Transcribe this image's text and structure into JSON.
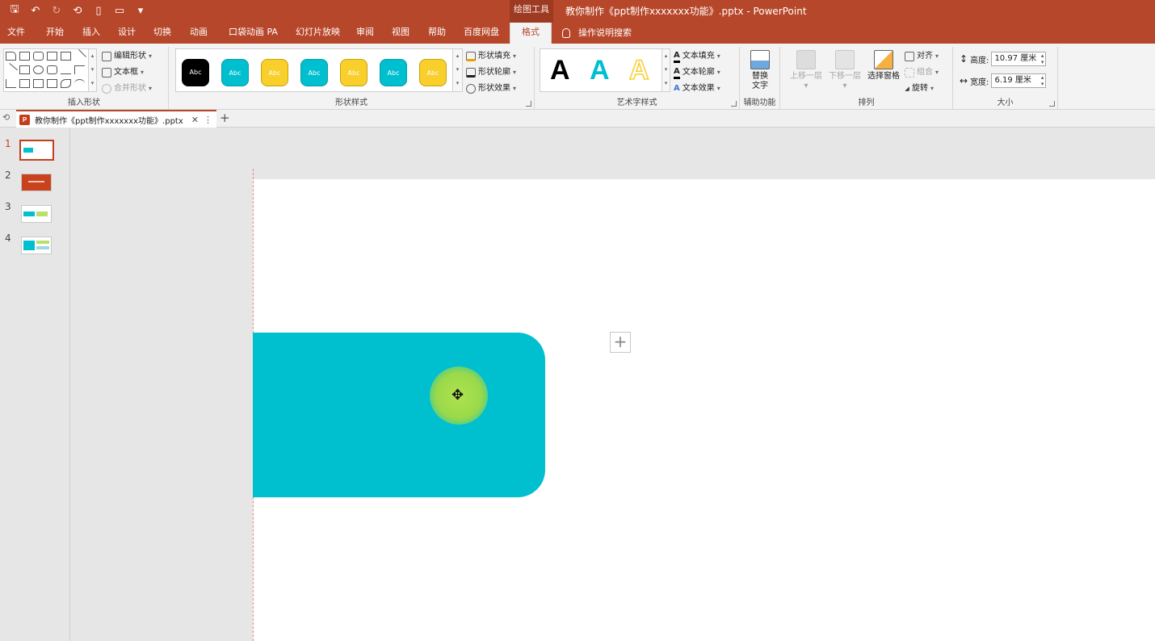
{
  "titlebar": {
    "context_tool": "绘图工具",
    "document_title": "教你制作《ppt制作xxxxxxx功能》.pptx  -  PowerPoint",
    "qat_more": "▾"
  },
  "tabs": [
    {
      "label": "文件"
    },
    {
      "label": "开始"
    },
    {
      "label": "插入"
    },
    {
      "label": "设计"
    },
    {
      "label": "切换"
    },
    {
      "label": "动画"
    },
    {
      "label": "口袋动画 PA"
    },
    {
      "label": "幻灯片放映"
    },
    {
      "label": "审阅"
    },
    {
      "label": "视图"
    },
    {
      "label": "帮助"
    },
    {
      "label": "百度网盘"
    },
    {
      "label": "格式"
    }
  ],
  "tell_me": "操作说明搜索",
  "ribbon": {
    "insert_shapes": {
      "label": "插入形状",
      "edit_shape": "编辑形状",
      "text_box": "文本框",
      "merge_shapes": "合并形状"
    },
    "shape_styles": {
      "label": "形状样式",
      "swatch_text": "Abc",
      "fill": "形状填充",
      "outline": "形状轮廓",
      "effects": "形状效果"
    },
    "wordart": {
      "label": "艺术字样式",
      "letter": "A",
      "text_fill": "文本填充",
      "text_outline": "文本轮廓",
      "text_effects": "文本效果"
    },
    "accessibility": {
      "label": "辅助功能",
      "alt_text_line1": "替换",
      "alt_text_line2": "文字"
    },
    "arrange": {
      "label": "排列",
      "bring_forward": "上移一层",
      "send_backward": "下移一层",
      "selection_pane": "选择窗格",
      "align": "对齐",
      "group": "组合",
      "rotate": "旋转"
    },
    "size": {
      "label": "大小",
      "height_label": "高度:",
      "height_value": "10.97 厘米",
      "width_label": "宽度:",
      "width_value": "6.19 厘米"
    }
  },
  "doc_tab": {
    "title": "教你制作《ppt制作xxxxxxx功能》.pptx",
    "icon_letter": "P",
    "close": "✕",
    "more": "⋮",
    "new": "+"
  },
  "slides": [
    {
      "number": "1",
      "active": true
    },
    {
      "number": "2",
      "active": false
    },
    {
      "number": "3",
      "active": false
    },
    {
      "number": "4",
      "active": false
    }
  ],
  "colors": {
    "accent": "#b7472a",
    "shape_fill": "#00bfcf",
    "click_highlight": "#9ad94a",
    "swatch_black": "#000000",
    "swatch_teal": "#00bfcf",
    "swatch_yellow": "#f8cf2b"
  },
  "canvas": {
    "add_button": "+",
    "cursor_glyph": "✥"
  }
}
